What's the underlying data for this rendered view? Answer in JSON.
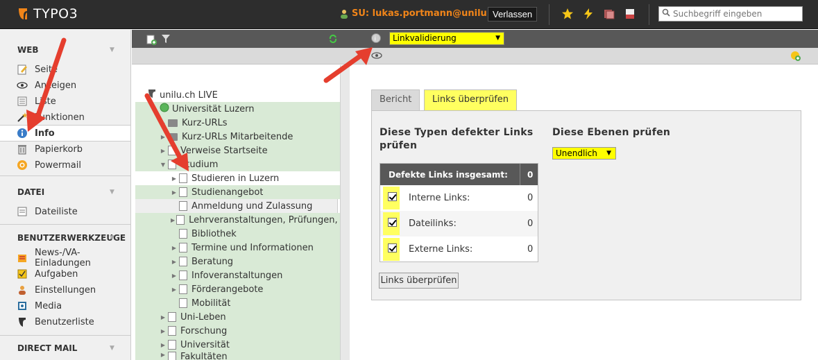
{
  "topbar": {
    "logo_text": "TYPO3",
    "switch_user": "SU: lukas.portmann@unilu.ch",
    "logout_label": "Verlassen",
    "search_placeholder": "Suchbegriff eingeben",
    "accent": "#f18519"
  },
  "modmenu": {
    "groups": [
      {
        "title": "WEB",
        "items": [
          "Seite",
          "Anzeigen",
          "Liste",
          "Funktionen",
          "Info",
          "Papierkorb",
          "Powermail"
        ]
      },
      {
        "title": "DATEI",
        "items": [
          "Dateiliste"
        ]
      },
      {
        "title": "BENUTZERWERKZEUGE",
        "items": [
          "News-/VA-Einladungen",
          "Aufgaben",
          "Einstellungen",
          "Media",
          "Benutzerliste"
        ]
      },
      {
        "title": "DIRECT MAIL",
        "items": []
      }
    ],
    "active_item": "Info"
  },
  "docheader": {
    "function_select": "Linkvalidierung"
  },
  "tree": {
    "root": "unilu.ch LIVE",
    "nodes": [
      "Universität Luzern",
      "Kurz-URLs",
      "Kurz-URLs Mitarbeitende",
      "Verweise Startseite",
      "Studium",
      "Studieren in Luzern",
      "Studienangebot",
      "Anmeldung und Zulassung",
      "Lehrveranstaltungen, Prüfungen, R",
      "Bibliothek",
      "Termine und Informationen",
      "Beratung",
      "Infoveranstaltungen",
      "Förderangebote",
      "Mobilität",
      "Uni-Leben",
      "Forschung",
      "Universität",
      "Fakultäten"
    ]
  },
  "content": {
    "tabs": [
      "Bericht",
      "Links überprüfen"
    ],
    "active_tab": "Links überprüfen",
    "types_heading": "Diese Typen defekter Links prüfen",
    "levels_heading": "Diese Ebenen prüfen",
    "levels_value": "Unendlich",
    "stats": {
      "header_label": "Defekte Links insgesamt:",
      "header_value": "0",
      "rows": [
        {
          "label": "Interne Links:",
          "value": "0",
          "checked": true
        },
        {
          "label": "Dateilinks:",
          "value": "0",
          "checked": true
        },
        {
          "label": "Externe Links:",
          "value": "0",
          "checked": true
        }
      ]
    },
    "check_button": "Links überprüfen"
  }
}
